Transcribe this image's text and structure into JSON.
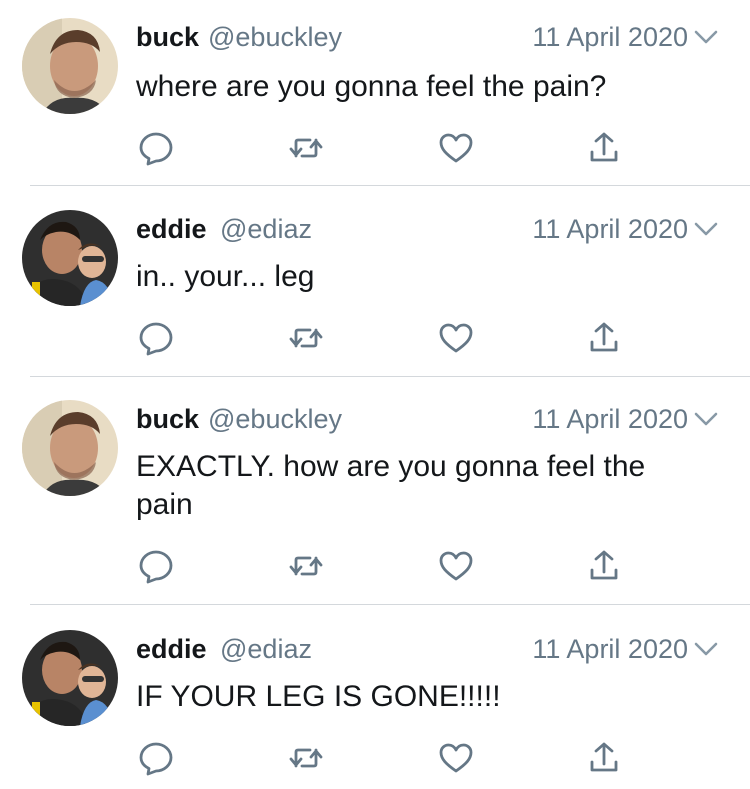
{
  "tweets": [
    {
      "name": "buck",
      "handle": "@ebuckley",
      "date": "11 April 2020",
      "text": "where are you gonna feel the pain?",
      "avatar": "buck-avatar"
    },
    {
      "name": "eddie",
      "handle": "@ediaz",
      "date": "11 April 2020",
      "text": "in.. your... leg",
      "avatar": "eddie-avatar"
    },
    {
      "name": "buck",
      "handle": "@ebuckley",
      "date": "11 April 2020",
      "text": "EXACTLY. how are you gonna feel the pain",
      "avatar": "buck-avatar"
    },
    {
      "name": "eddie",
      "handle": "@ediaz",
      "date": "11 April 2020",
      "text": "IF YOUR LEG IS GONE!!!!!",
      "avatar": "eddie-avatar"
    }
  ],
  "icons": {
    "reply": "reply-icon",
    "retweet": "retweet-icon",
    "like": "heart-icon",
    "share": "share-icon",
    "menu": "chevron-down-icon"
  },
  "colors": {
    "text": "#14171a",
    "secondary": "#657786",
    "icon": "#657786",
    "separator": "#d4d8dc"
  }
}
